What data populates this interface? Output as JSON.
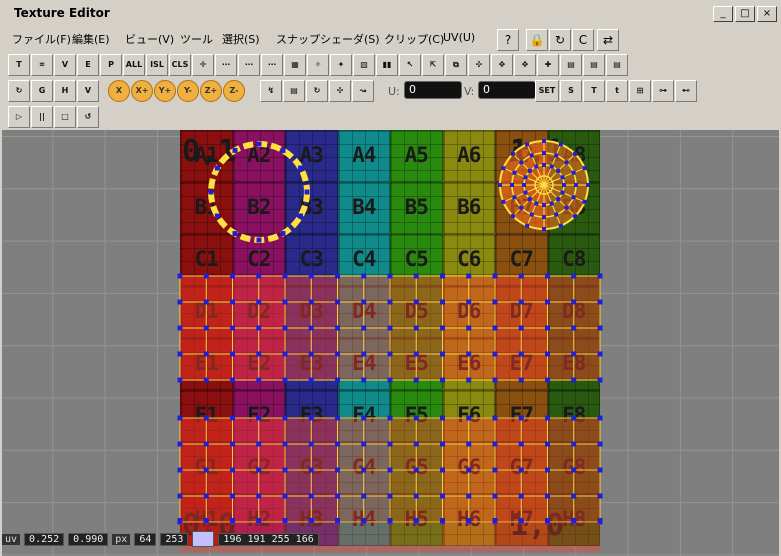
{
  "window": {
    "title": "Texture Editor"
  },
  "window_buttons": [
    "_",
    "□",
    "×"
  ],
  "menubar": {
    "items": [
      "ファイル(F)",
      "編集(E)",
      "ビュー(V)",
      "ツール",
      "選択(S)",
      "スナップ",
      "シェーダ(S)",
      "クリップ(C)",
      "UV(U)"
    ]
  },
  "toolbar1": {
    "buttons": [
      "T",
      "⌗",
      "V",
      "E",
      "P",
      "ALL",
      "ISL",
      "CLS",
      "✛",
      "⋯",
      "⋯",
      "⋯",
      "▦",
      "✧",
      "✦",
      "▧",
      "▮▮",
      "↖",
      "⇱",
      "⧉",
      "✣",
      "✥",
      "✥",
      "✚",
      "▤",
      "▤",
      "▤"
    ]
  },
  "toolbar2": {
    "buttons_left": [
      "↻",
      "G",
      "H",
      "V"
    ],
    "axis_buttons": [
      "X",
      "X+",
      "Y+",
      "Y-",
      "Z+",
      "Z-"
    ],
    "buttons_mid": [
      "↯",
      "▤",
      "↻",
      "✣",
      "↝"
    ],
    "u_label": "U:",
    "u_value": "0",
    "v_label": "V:",
    "v_value": "0",
    "set_label": "SET",
    "buttons_right": [
      "S",
      "T",
      "t",
      "⊞",
      "⊶",
      "⊷"
    ]
  },
  "toolbar3": {
    "buttons": [
      "▷",
      "||",
      "□",
      "↺"
    ]
  },
  "grid": {
    "rows": [
      [
        "A1",
        "A2",
        "A3",
        "A4",
        "A5",
        "A6",
        "A7",
        "A8"
      ],
      [
        "B1",
        "B2",
        "B3",
        "B4",
        "B5",
        "B6",
        "B7",
        "B8"
      ],
      [
        "C1",
        "C2",
        "C3",
        "C4",
        "C5",
        "C6",
        "C7",
        "C8"
      ],
      [
        "D1",
        "D2",
        "D3",
        "D4",
        "D5",
        "D6",
        "D7",
        "D8"
      ],
      [
        "E1",
        "E2",
        "E3",
        "E4",
        "E5",
        "E6",
        "E7",
        "E8"
      ],
      [
        "F1",
        "F2",
        "F3",
        "F4",
        "F5",
        "F6",
        "F7",
        "F8"
      ],
      [
        "G1",
        "G2",
        "G3",
        "G4",
        "G5",
        "G6",
        "G7",
        "G8"
      ],
      [
        "H1",
        "H2",
        "H3",
        "H4",
        "H5",
        "H6",
        "H7",
        "H8"
      ]
    ],
    "column_colors": [
      "#8a1010",
      "#8a1060",
      "#2a2a8a",
      "#108a8a",
      "#2a8a10",
      "#8a8a10",
      "#8a5010",
      "#2a5a10"
    ],
    "corner_labels": {
      "top_left": "0,1",
      "top_right": "1,1",
      "bottom_left": "0,0",
      "bottom_right": "1,0"
    }
  },
  "status": {
    "uv_label": "uv",
    "uv_u": "0.252",
    "uv_v": "0.990",
    "px_label": "px",
    "px_x": "64",
    "px_y": "253",
    "color_value": "196 191 255 166"
  }
}
